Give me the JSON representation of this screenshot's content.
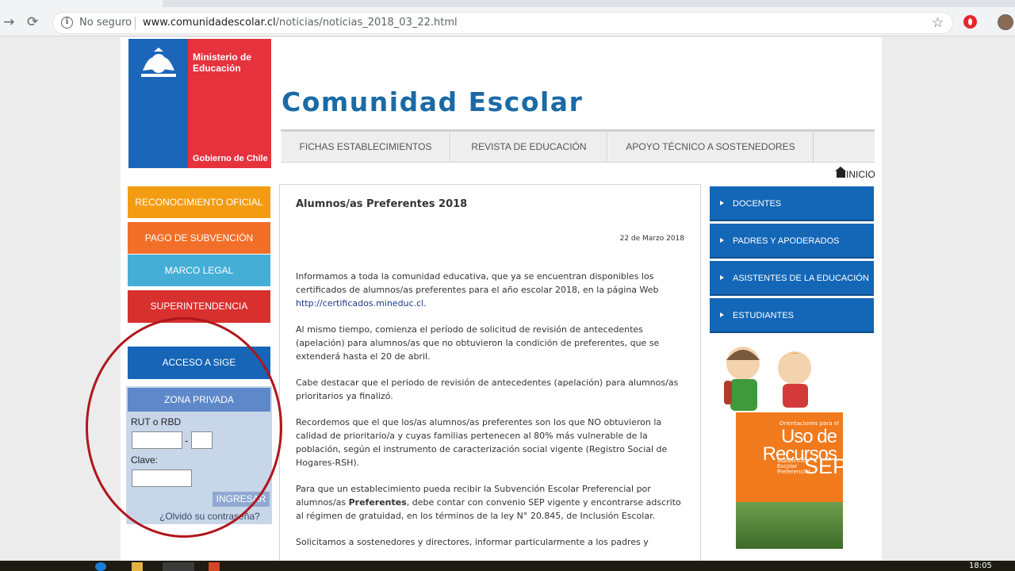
{
  "browser": {
    "security_label": "No seguro",
    "url_domain": "www.comunidadescolar.cl",
    "url_path": "/noticias/noticias_2018_03_22.html"
  },
  "logo": {
    "ministry": "Ministerio de Educación",
    "government": "Gobierno de Chile"
  },
  "site_title": "Comunidad Escolar",
  "topnav": [
    "FICHAS ESTABLECIMIENTOS",
    "REVISTA DE EDUCACIÓN",
    "APOYO TÉCNICO A SOSTENEDORES"
  ],
  "home_link": "INICIO",
  "left_menu": {
    "reconocimiento": "RECONOCIMIENTO OFICIAL",
    "pago": "PAGO DE SUBVENCIÓN",
    "marco": "MARCO LEGAL",
    "super": "SUPERINTENDENCIA",
    "sige": "ACCESO A SIGE"
  },
  "login": {
    "header": "ZONA PRIVADA",
    "rut_label": "RUT o RBD",
    "dash": "-",
    "password_label": "Clave:",
    "submit": "INGRESAR",
    "forgot": "¿Olvidó su contraseña?"
  },
  "article": {
    "title": "Alumnos/as Preferentes 2018",
    "date": "22 de Marzo 2018",
    "p1_text": "Informamos a toda la comunidad educativa, que ya se encuentran disponibles los certificados de alumnos/as preferentes para el año escolar 2018, en la página Web ",
    "p1_link": "http://certificados.mineduc.cl",
    "p1_end": ".",
    "p2": "Al mismo tiempo, comienza el período de solicitud de revisión de antecedentes (apelación) para alumnos/as que no obtuvieron la condición de preferentes, que se extenderá hasta el 20 de abril.",
    "p3": "Cabe destacar que el periodo de revisión de antecedentes (apelación) para alumnos/as prioritarios ya finalizó.",
    "p4": "Recordemos que el que los/as alumnos/as preferentes son los que NO obtuvieron la calidad de prioritario/a y cuyas familias pertenecen al 80% más vulnerable de la población, según el instrumento de caracterización social vigente (Registro Social de Hogares-RSH).",
    "p5_start": "Para que un establecimiento pueda recibir la Subvención Escolar Preferencial por alumnos/as ",
    "p5_bold": "Preferentes",
    "p5_end": ", debe contar con convenio SEP vigente y encontrarse adscrito al régimen de gratuidad, en los términos de la ley N° 20.845, de Inclusión Escolar.",
    "p6": "Solicitamos a sostenedores y directores, informar particularmente a los padres y"
  },
  "right_menu": [
    "DOCENTES",
    "PADRES Y APODERADOS",
    "ASISTENTES DE LA EDUCACIÓN",
    "ESTUDIANTES"
  ],
  "promo": {
    "small": "Orientaciones para el",
    "big1": "Uso de",
    "big2": "Recursos",
    "sub1": "Subvención",
    "sub2": "Escolar",
    "sub3": "Preferencial",
    "sep": "SEP"
  },
  "taskbar": {
    "time": "18:05"
  },
  "colors": {
    "reconocimiento": "#f39c12",
    "pago": "#f26f2a",
    "marco": "#45aed6",
    "super": "#d7302e",
    "sige": "#1665b6",
    "right_menu": "#1467b7",
    "title": "#1a6aa6"
  }
}
